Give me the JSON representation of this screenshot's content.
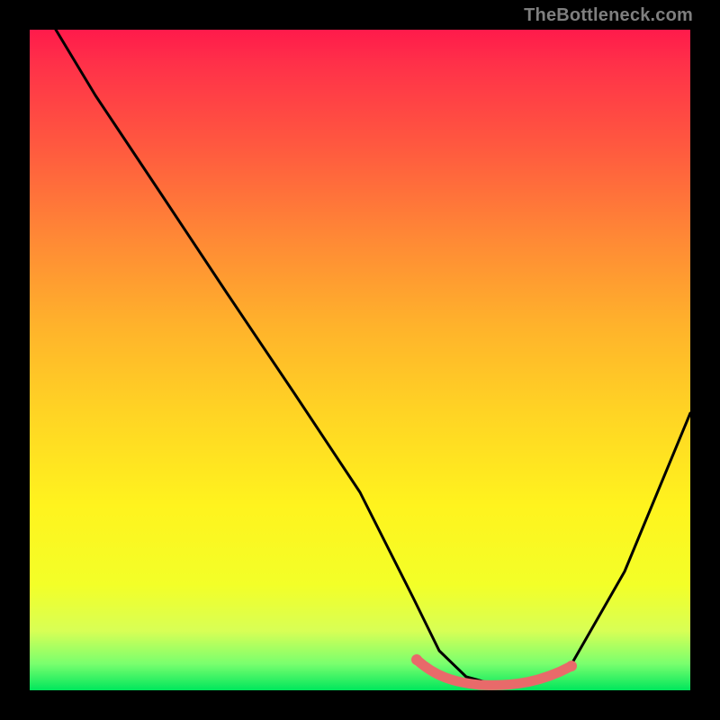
{
  "watermark": "TheBottleneck.com",
  "chart_data": {
    "type": "line",
    "title": "",
    "xlabel": "",
    "ylabel": "",
    "xlim": [
      0,
      100
    ],
    "ylim": [
      0,
      100
    ],
    "series": [
      {
        "name": "bottleneck-curve",
        "x": [
          4,
          10,
          20,
          30,
          40,
          50,
          58,
          62,
          66,
          70,
          74,
          78,
          82,
          90,
          100
        ],
        "values": [
          100,
          90,
          75,
          60,
          45,
          30,
          14,
          6,
          2,
          1,
          1,
          2,
          4,
          18,
          42
        ]
      }
    ],
    "valley_band": {
      "name": "optimal-range-marker",
      "x_start": 58,
      "x_end": 82,
      "y_approx": 2
    },
    "colors": {
      "curve": "#000000",
      "valley_marker": "#e86a6a",
      "background_top": "#ff1a4b",
      "background_bottom": "#00e65c",
      "frame": "#000000"
    }
  }
}
